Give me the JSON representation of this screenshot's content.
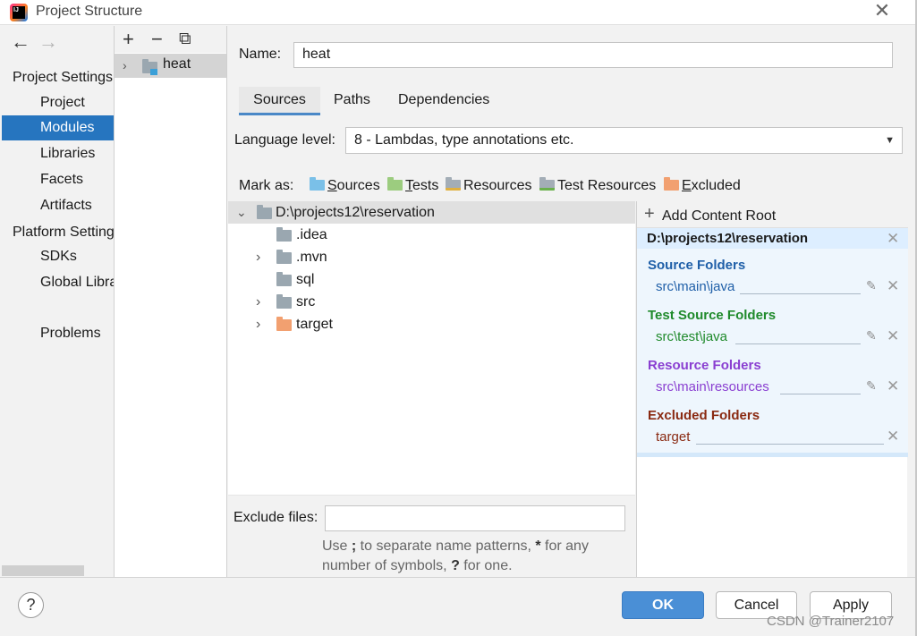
{
  "window": {
    "title": "Project Structure",
    "close_glyph": "✕"
  },
  "nav": {
    "back_glyph": "←",
    "forward_glyph": "→",
    "project_settings": "Project Settings",
    "project_items": [
      "Project",
      "Modules",
      "Libraries",
      "Facets",
      "Artifacts"
    ],
    "platform_settings": "Platform Settings",
    "platform_items": [
      "SDKs",
      "Global Libraries"
    ],
    "problems": "Problems",
    "selected": "Modules"
  },
  "modules": {
    "toolbar": {
      "add": "+",
      "remove": "−",
      "copy": "⧉"
    },
    "items": [
      "heat"
    ]
  },
  "main": {
    "name_label": "Name:",
    "name_value": "heat",
    "tabs": [
      "Sources",
      "Paths",
      "Dependencies"
    ],
    "selected_tab": "Sources",
    "language_label": "Language level:",
    "language_value": "8 - Lambdas, type annotations etc.",
    "mark_as_label": "Mark as:",
    "mark_buttons": [
      {
        "first": "S",
        "rest": "ources",
        "color": "#7ac0e8"
      },
      {
        "first": "T",
        "rest": "ests",
        "color": "#9ccc7f"
      },
      {
        "first": "",
        "rest": "Resources",
        "color": "#a3adb6"
      },
      {
        "first": "",
        "rest": "Test Resources",
        "color": "#a3adb6"
      },
      {
        "first": "E",
        "rest": "xcluded",
        "color": "#f2a070"
      }
    ]
  },
  "tree": {
    "root": "D:\\projects12\\reservation",
    "children": [
      {
        "name": ".idea",
        "expandable": false,
        "color": "#a3adb6"
      },
      {
        "name": ".mvn",
        "expandable": true,
        "color": "#a3adb6"
      },
      {
        "name": "sql",
        "expandable": false,
        "color": "#a3adb6"
      },
      {
        "name": "src",
        "expandable": true,
        "color": "#a3adb6"
      },
      {
        "name": "target",
        "expandable": true,
        "color": "#f2a070"
      }
    ]
  },
  "content_root": {
    "add_label": "Add Content Root",
    "path": "D:\\projects12\\reservation",
    "sections": [
      {
        "title": "Source Folders",
        "entry": "src\\main\\java",
        "color": "#1f5fa8",
        "editable": true
      },
      {
        "title": "Test Source Folders",
        "entry": "src\\test\\java",
        "color": "#1f8a2b",
        "editable": true
      },
      {
        "title": "Resource Folders",
        "entry": "src\\main\\resources",
        "color": "#8a3fd1",
        "editable": true
      },
      {
        "title": "Excluded Folders",
        "entry": "target",
        "color": "#8a2a12",
        "editable": false
      }
    ]
  },
  "exclude": {
    "label": "Exclude files:",
    "value": "",
    "hint_1": "Use ",
    "hint_semicolon": ";",
    "hint_2": " to separate name patterns, ",
    "hint_star": "*",
    "hint_3": " for any number of symbols, ",
    "hint_q": "?",
    "hint_4": " for one."
  },
  "footer": {
    "help": "?",
    "ok": "OK",
    "cancel": "Cancel",
    "apply": "Apply"
  },
  "watermark": "CSDN @Trainer2107"
}
